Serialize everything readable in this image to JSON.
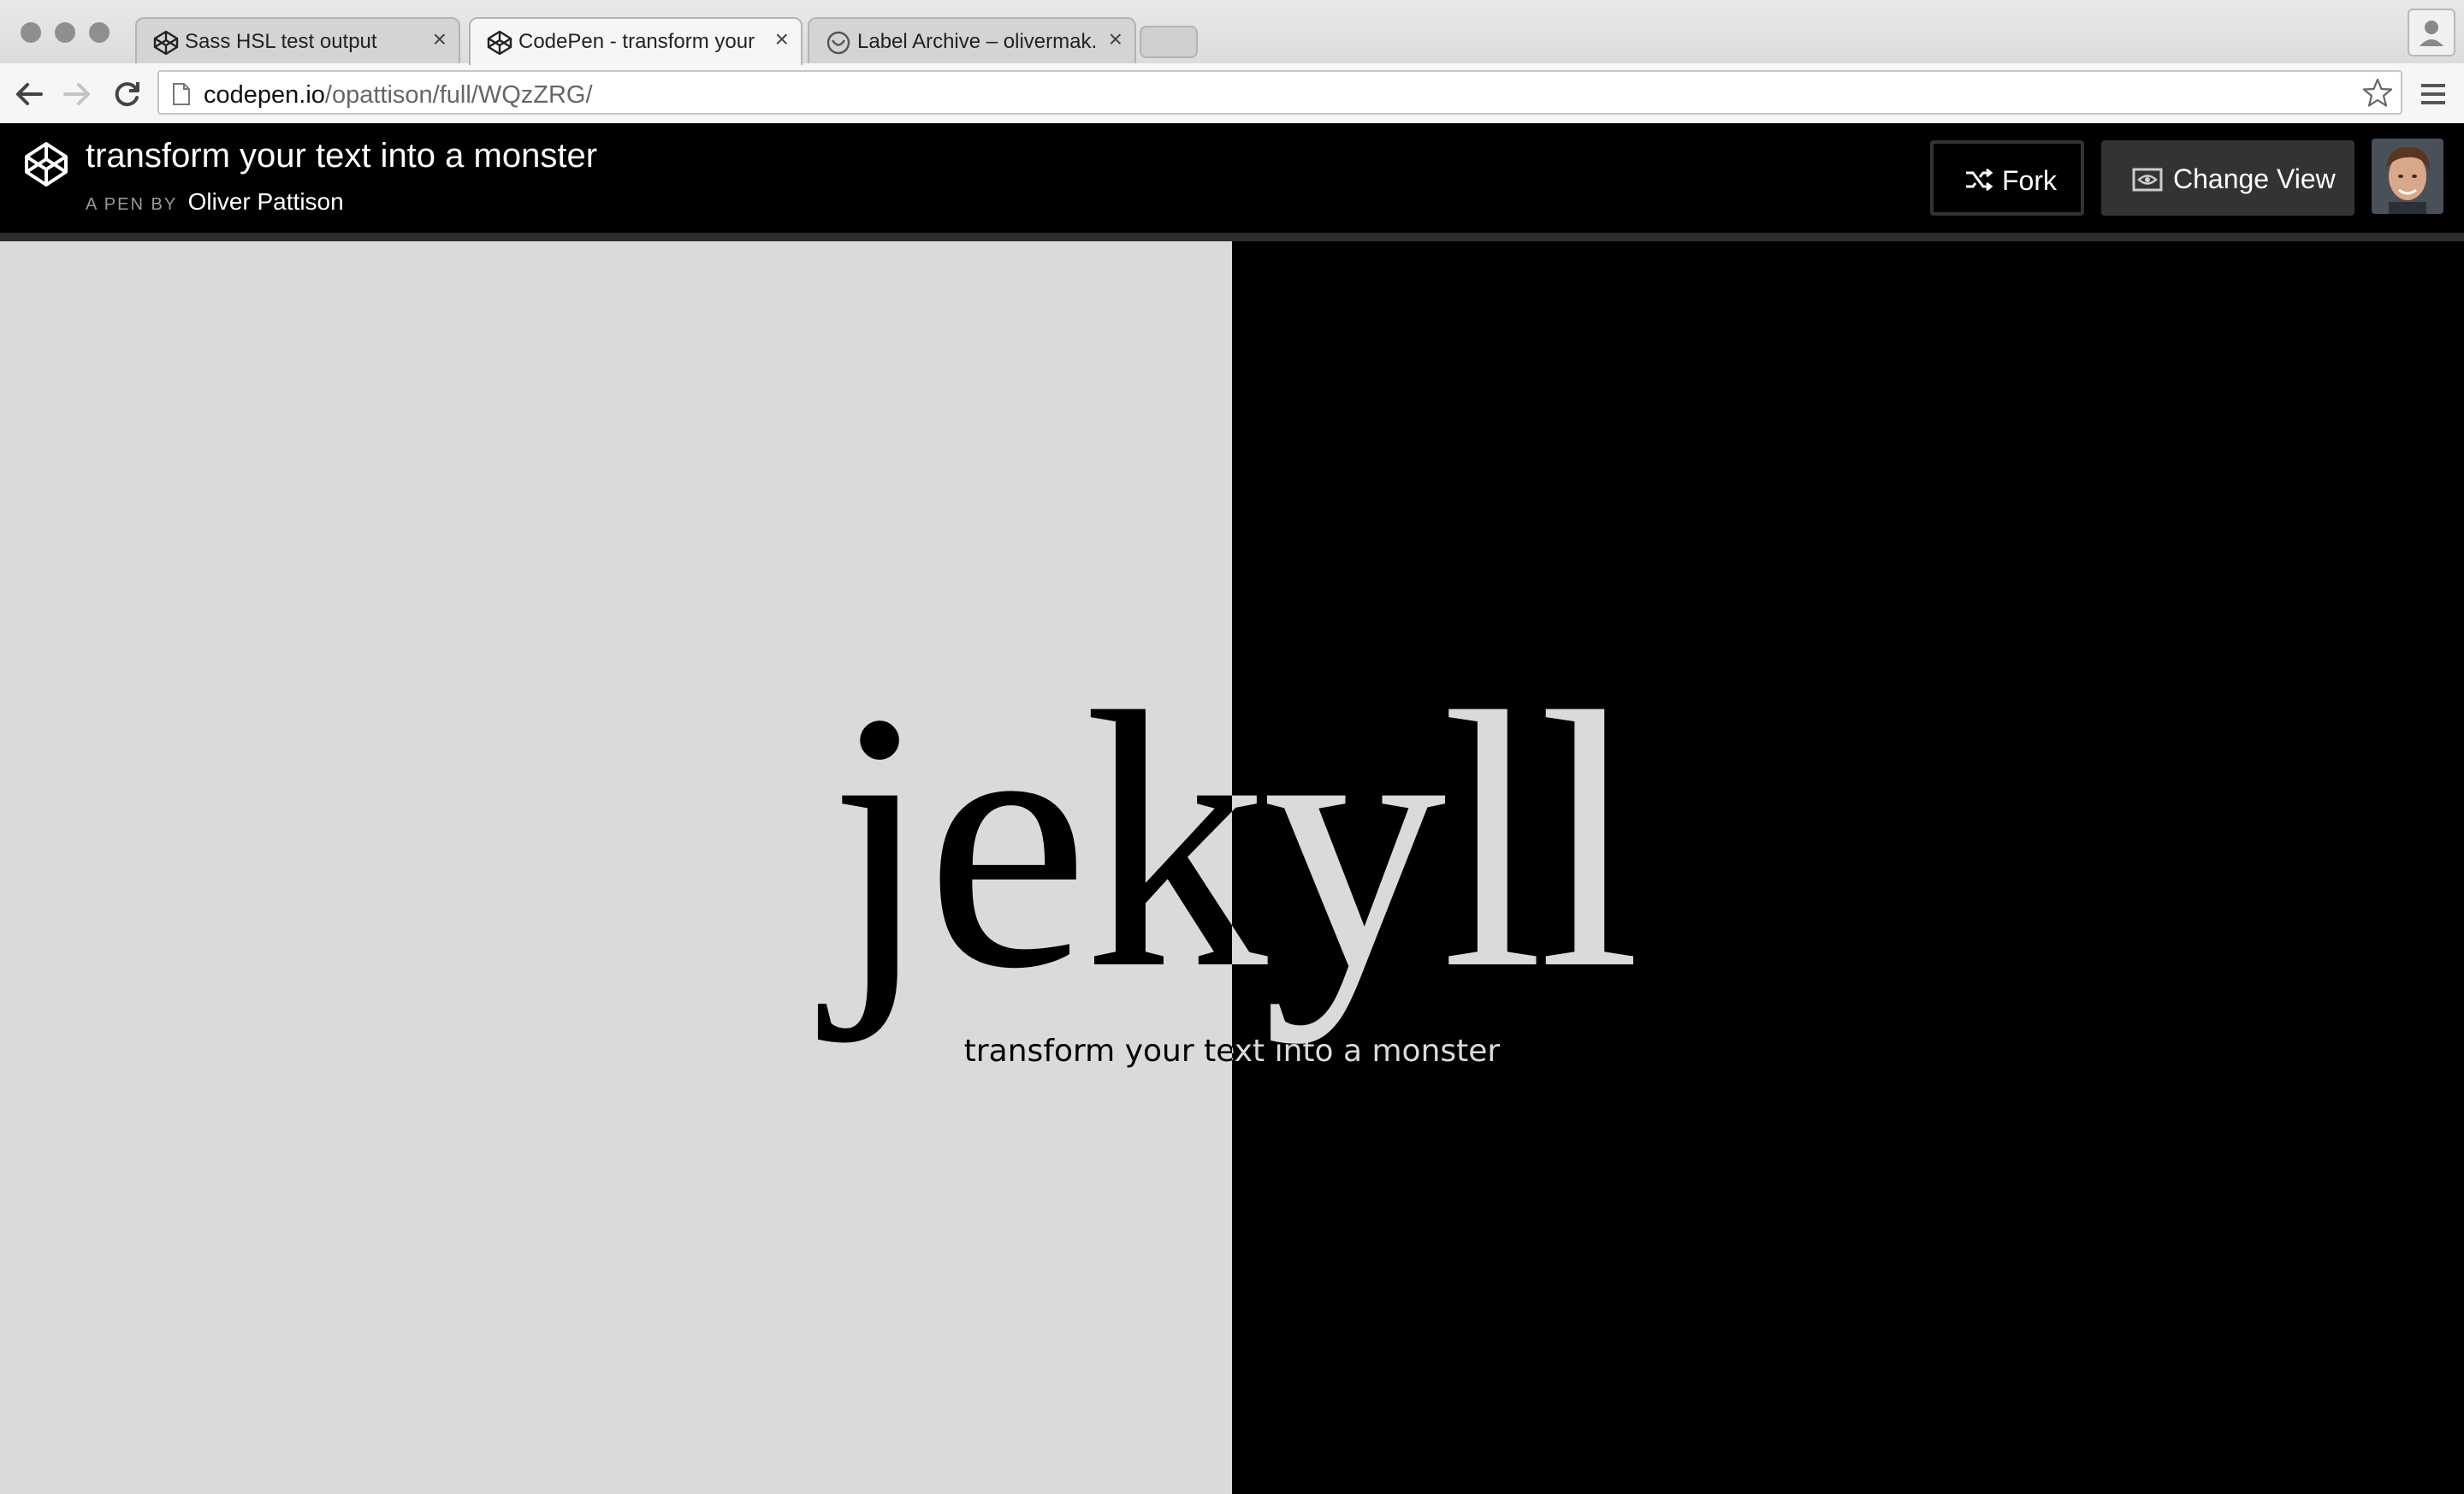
{
  "browser": {
    "tabs": [
      {
        "title": "Sass HSL test output",
        "icon": "codepen-icon",
        "active": false
      },
      {
        "title": "CodePen - transform your t",
        "icon": "codepen-icon",
        "active": true
      },
      {
        "title": "Label Archive – olivermak.e",
        "icon": "wordpress-icon",
        "active": false
      }
    ],
    "url_host": "codepen.io",
    "url_path": "/opattison/full/WQzZRG/"
  },
  "pen": {
    "title": "transform your text into a monster",
    "byline_prefix": "A PEN BY",
    "author": "Oliver Pattison",
    "fork_label": "Fork",
    "change_view_label": "Change View"
  },
  "result": {
    "headline": "jekyll",
    "tagline": "transform your text into a monster"
  },
  "colors": {
    "light_half": "#dadada",
    "dark_half": "#000000"
  }
}
